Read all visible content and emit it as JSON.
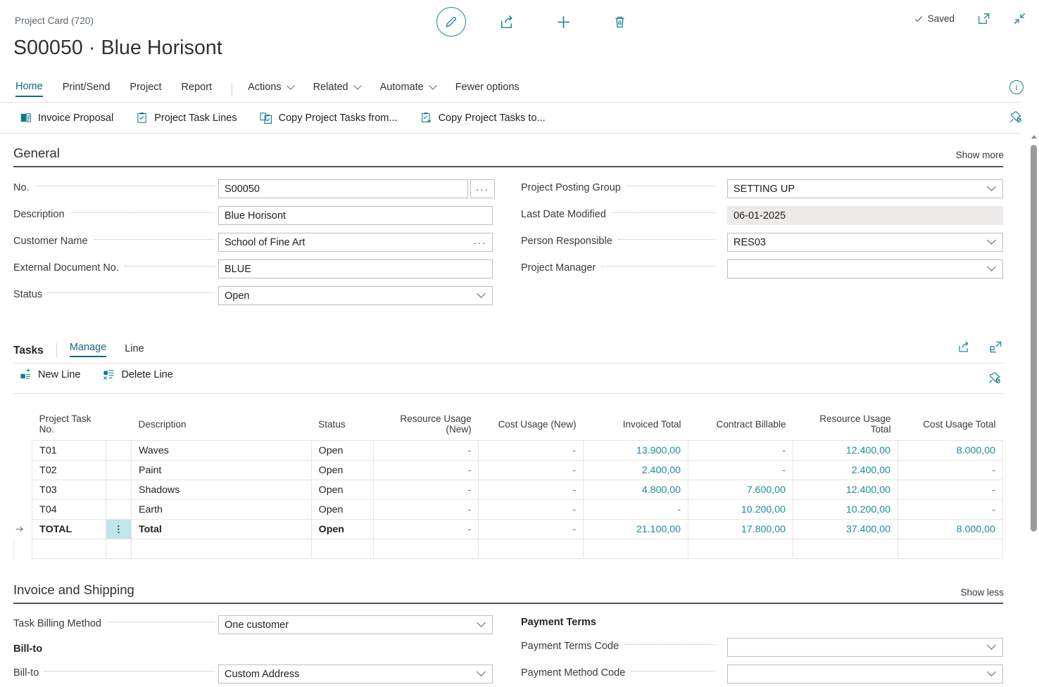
{
  "window": {
    "breadcrumb": "Project Card (720)",
    "title": "S00050 · Blue Horisont",
    "saved_label": "Saved"
  },
  "top_actions": [
    {
      "name": "edit-icon",
      "label": "Edit"
    },
    {
      "name": "share-icon",
      "label": "Share"
    },
    {
      "name": "new-icon",
      "label": "New"
    },
    {
      "name": "delete-icon",
      "label": "Delete"
    }
  ],
  "top_right": [
    {
      "name": "open-in-new-window-icon",
      "label": "Open in new window"
    },
    {
      "name": "collapse-icon",
      "label": "Collapse"
    }
  ],
  "menu": {
    "items": [
      {
        "label": "Home",
        "active": true,
        "chevron": false
      },
      {
        "label": "Print/Send",
        "active": false,
        "chevron": false
      },
      {
        "label": "Project",
        "active": false,
        "chevron": false
      },
      {
        "label": "Report",
        "active": false,
        "chevron": false
      }
    ],
    "items2": [
      {
        "label": "Actions",
        "chevron": true
      },
      {
        "label": "Related",
        "chevron": true
      },
      {
        "label": "Automate",
        "chevron": true
      },
      {
        "label": "Fewer options",
        "chevron": false
      }
    ],
    "info_icon": "info-icon"
  },
  "ribbon": {
    "buttons": [
      {
        "label": "Invoice Proposal",
        "icon": "invoice-proposal-icon"
      },
      {
        "label": "Project Task Lines",
        "icon": "project-task-lines-icon"
      },
      {
        "label": "Copy Project Tasks from...",
        "icon": "copy-project-tasks-from-icon"
      },
      {
        "label": "Copy Project Tasks to...",
        "icon": "copy-project-tasks-to-icon"
      }
    ],
    "pin_icon": "unpin-icon"
  },
  "general": {
    "heading": "General",
    "show_more": "Show more",
    "left_fields": [
      {
        "label": "No.",
        "value": "S00050",
        "control": "text-assist",
        "placeholder": ""
      },
      {
        "label": "Description",
        "value": "Blue Horisont",
        "control": "text",
        "placeholder": ""
      },
      {
        "label": "Customer Name",
        "value": "School of Fine Art",
        "control": "text-ellipsis",
        "placeholder": ""
      },
      {
        "label": "External Document No.",
        "value": "BLUE",
        "control": "text",
        "placeholder": ""
      },
      {
        "label": "Status",
        "value": "Open",
        "control": "dropdown",
        "placeholder": ""
      }
    ],
    "right_fields": [
      {
        "label": "Project Posting Group",
        "value": "SETTING UP",
        "control": "dropdown",
        "placeholder": ""
      },
      {
        "label": "Last Date Modified",
        "value": "06-01-2025",
        "control": "readonly",
        "placeholder": ""
      },
      {
        "label": "Person Responsible",
        "value": "RES03",
        "control": "dropdown",
        "placeholder": ""
      },
      {
        "label": "Project Manager",
        "value": "",
        "control": "dropdown",
        "placeholder": ""
      }
    ]
  },
  "tasks": {
    "heading": "Tasks",
    "tabs": [
      {
        "label": "Manage",
        "active": true
      },
      {
        "label": "Line",
        "active": false
      }
    ],
    "actions": [
      {
        "label": "New Line",
        "icon": "new-line-icon"
      },
      {
        "label": "Delete Line",
        "icon": "delete-line-icon"
      }
    ],
    "header_icons": [
      {
        "name": "share-grid-icon",
        "label": "Share"
      },
      {
        "name": "open-in-excel-icon",
        "label": "Open in Excel"
      }
    ],
    "pin_icon": "unpin-icon",
    "columns": [
      {
        "label": "Project Task No.",
        "align": "left"
      },
      {
        "label": "",
        "align": "left"
      },
      {
        "label": "Description",
        "align": "left"
      },
      {
        "label": "Status",
        "align": "left"
      },
      {
        "label": "Resource Usage (New)",
        "align": "right"
      },
      {
        "label": "Cost Usage (New)",
        "align": "right"
      },
      {
        "label": "Invoiced Total",
        "align": "right"
      },
      {
        "label": "Contract Billable",
        "align": "right"
      },
      {
        "label": "Resource Usage Total",
        "align": "right"
      },
      {
        "label": "Cost Usage Total",
        "align": "right"
      }
    ],
    "rows": [
      {
        "selected": false,
        "bold": false,
        "task_no": "T01",
        "description": "Waves",
        "status": "Open",
        "resource_usage_new": "-",
        "cost_usage_new": "-",
        "invoiced_total": "13.900,00",
        "contract_billable": "-",
        "resource_usage_total": "12.400,00",
        "cost_usage_total": "8.000,00"
      },
      {
        "selected": false,
        "bold": false,
        "task_no": "T02",
        "description": "Paint",
        "status": "Open",
        "resource_usage_new": "-",
        "cost_usage_new": "-",
        "invoiced_total": "2.400,00",
        "contract_billable": "-",
        "resource_usage_total": "2.400,00",
        "cost_usage_total": "-"
      },
      {
        "selected": false,
        "bold": false,
        "task_no": "T03",
        "description": "Shadows",
        "status": "Open",
        "resource_usage_new": "-",
        "cost_usage_new": "-",
        "invoiced_total": "4.800,00",
        "contract_billable": "7.600,00",
        "resource_usage_total": "12.400,00",
        "cost_usage_total": "-"
      },
      {
        "selected": false,
        "bold": false,
        "task_no": "T04",
        "description": "Earth",
        "status": "Open",
        "resource_usage_new": "-",
        "cost_usage_new": "-",
        "invoiced_total": "-",
        "contract_billable": "10.200,00",
        "resource_usage_total": "10.200,00",
        "cost_usage_total": "-"
      },
      {
        "selected": true,
        "bold": true,
        "task_no": "TOTAL",
        "description": "Total",
        "status": "Open",
        "resource_usage_new": "-",
        "cost_usage_new": "-",
        "invoiced_total": "21.100,00",
        "contract_billable": "17.800,00",
        "resource_usage_total": "37.400,00",
        "cost_usage_total": "8.000,00"
      }
    ]
  },
  "invoice_shipping": {
    "heading": "Invoice and Shipping",
    "show_less": "Show less",
    "left_fields": [
      {
        "label": "Task Billing Method",
        "value": "One customer",
        "control": "dropdown"
      },
      {
        "label": "Bill-to",
        "value": "",
        "control": "subheading"
      },
      {
        "label": "Bill-to",
        "value": "Custom Address",
        "control": "dropdown"
      }
    ],
    "right_fields": [
      {
        "label": "Payment Terms",
        "value": "",
        "control": "subheading"
      },
      {
        "label": "Payment Terms Code",
        "value": "",
        "control": "dropdown"
      },
      {
        "label": "Payment Method Code",
        "value": "",
        "control": "dropdown"
      }
    ]
  },
  "colors": {
    "accent_teal": "#15808f",
    "link_teal": "#0f6b78",
    "number_teal": "#1a8b9d",
    "selection_bg": "#bfe6ea",
    "text": "#201f1e",
    "muted_text": "#3b3a39",
    "border": "#e6e4e2"
  }
}
